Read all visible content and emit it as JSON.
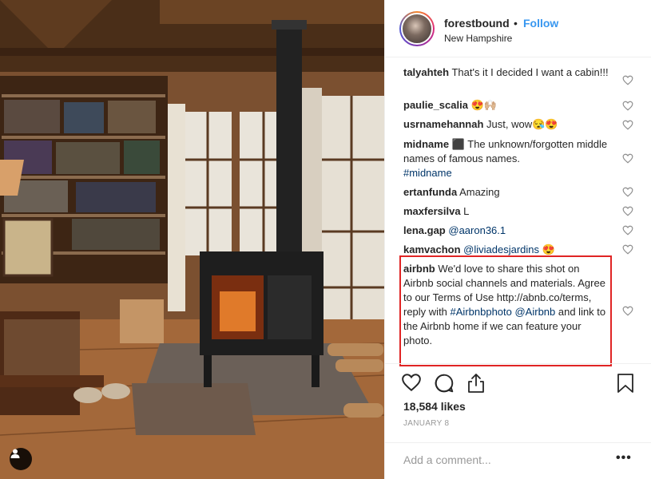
{
  "post": {
    "username": "forestbound",
    "separator": "•",
    "follow_label": "Follow",
    "location": "New Hampshire",
    "likes": "18,584 likes",
    "date": "JANUARY 8",
    "add_comment_placeholder": "Add a comment...",
    "more_label": "•••"
  },
  "comments": [
    {
      "user": "talyahteh",
      "text": " That's it I decided I want a cabin!!!"
    },
    {
      "user": "paulie_scalia",
      "text": " 😍🙌🏼"
    },
    {
      "user": "usrnamehannah",
      "text": " Just, wow😪😍"
    },
    {
      "user": "midname",
      "text": " ⬛ The unknown/forgotten middle names of famous names.",
      "link": "#midname"
    },
    {
      "user": "ertanfunda",
      "text": " Amazing"
    },
    {
      "user": "maxfersilva",
      "text": " L"
    },
    {
      "user": "lena.gap",
      "link": "@aaron36.1"
    },
    {
      "user": "kamvachon",
      "link": "@liviadesjardins",
      "text": " 😍"
    },
    {
      "user": "airbnb",
      "text": " We'd love to share this shot on Airbnb social channels and materials. Agree to our Terms of Use http://abnb.co/terms, reply with ",
      "link": "#Airbnbphoto @Airbnb",
      "text2": " and link to the Airbnb home if we can feature your photo."
    }
  ],
  "icons": {
    "heart": "heart-icon",
    "comment": "comment-icon",
    "share": "share-icon",
    "bookmark": "bookmark-icon",
    "user_tag": "user-icon"
  },
  "colors": {
    "follow": "#3897f0",
    "link": "#003569",
    "highlight": "#e02424"
  }
}
